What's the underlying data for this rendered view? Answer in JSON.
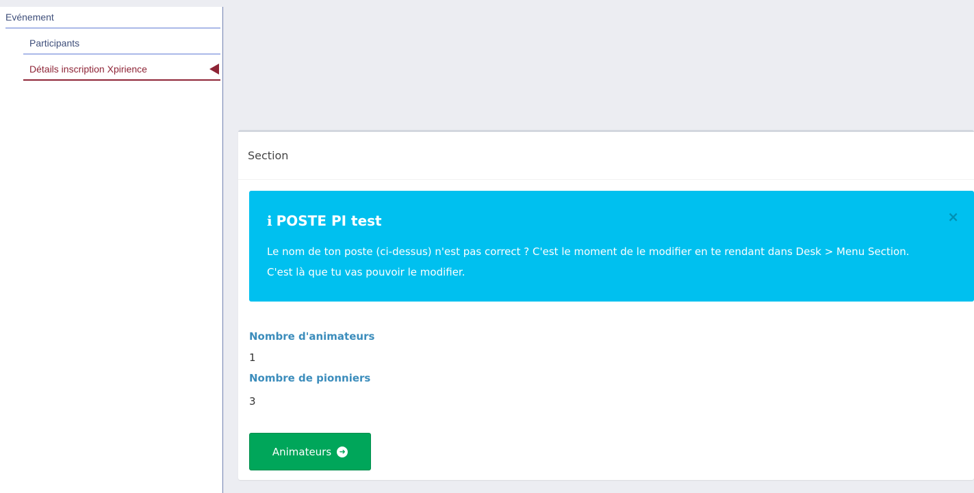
{
  "sidebar": {
    "root_label": "Evénement",
    "items": [
      {
        "label": "Participants"
      },
      {
        "label": "Détails inscription Xpirience"
      }
    ]
  },
  "card": {
    "header": "Section",
    "alert": {
      "title": "POSTE PI test",
      "body": "Le nom de ton poste (ci-dessus) n'est pas correct ? C'est le moment de le modifier en te rendant dans Desk > Menu Section. C'est là que tu vas pouvoir le modifier.",
      "close_glyph": "×",
      "icon": "info-icon"
    },
    "fields": [
      {
        "label": "Nombre d'animateurs",
        "value": "1"
      },
      {
        "label": "Nombre de pionniers",
        "value": "3"
      }
    ],
    "button": {
      "label": "Animateurs",
      "icon": "circle-arrow-right-icon"
    }
  },
  "colors": {
    "alert_bg": "#00c0ef",
    "button_bg": "#00a65a",
    "active_nav": "#8e2436",
    "label_blue": "#3c8dbc"
  }
}
